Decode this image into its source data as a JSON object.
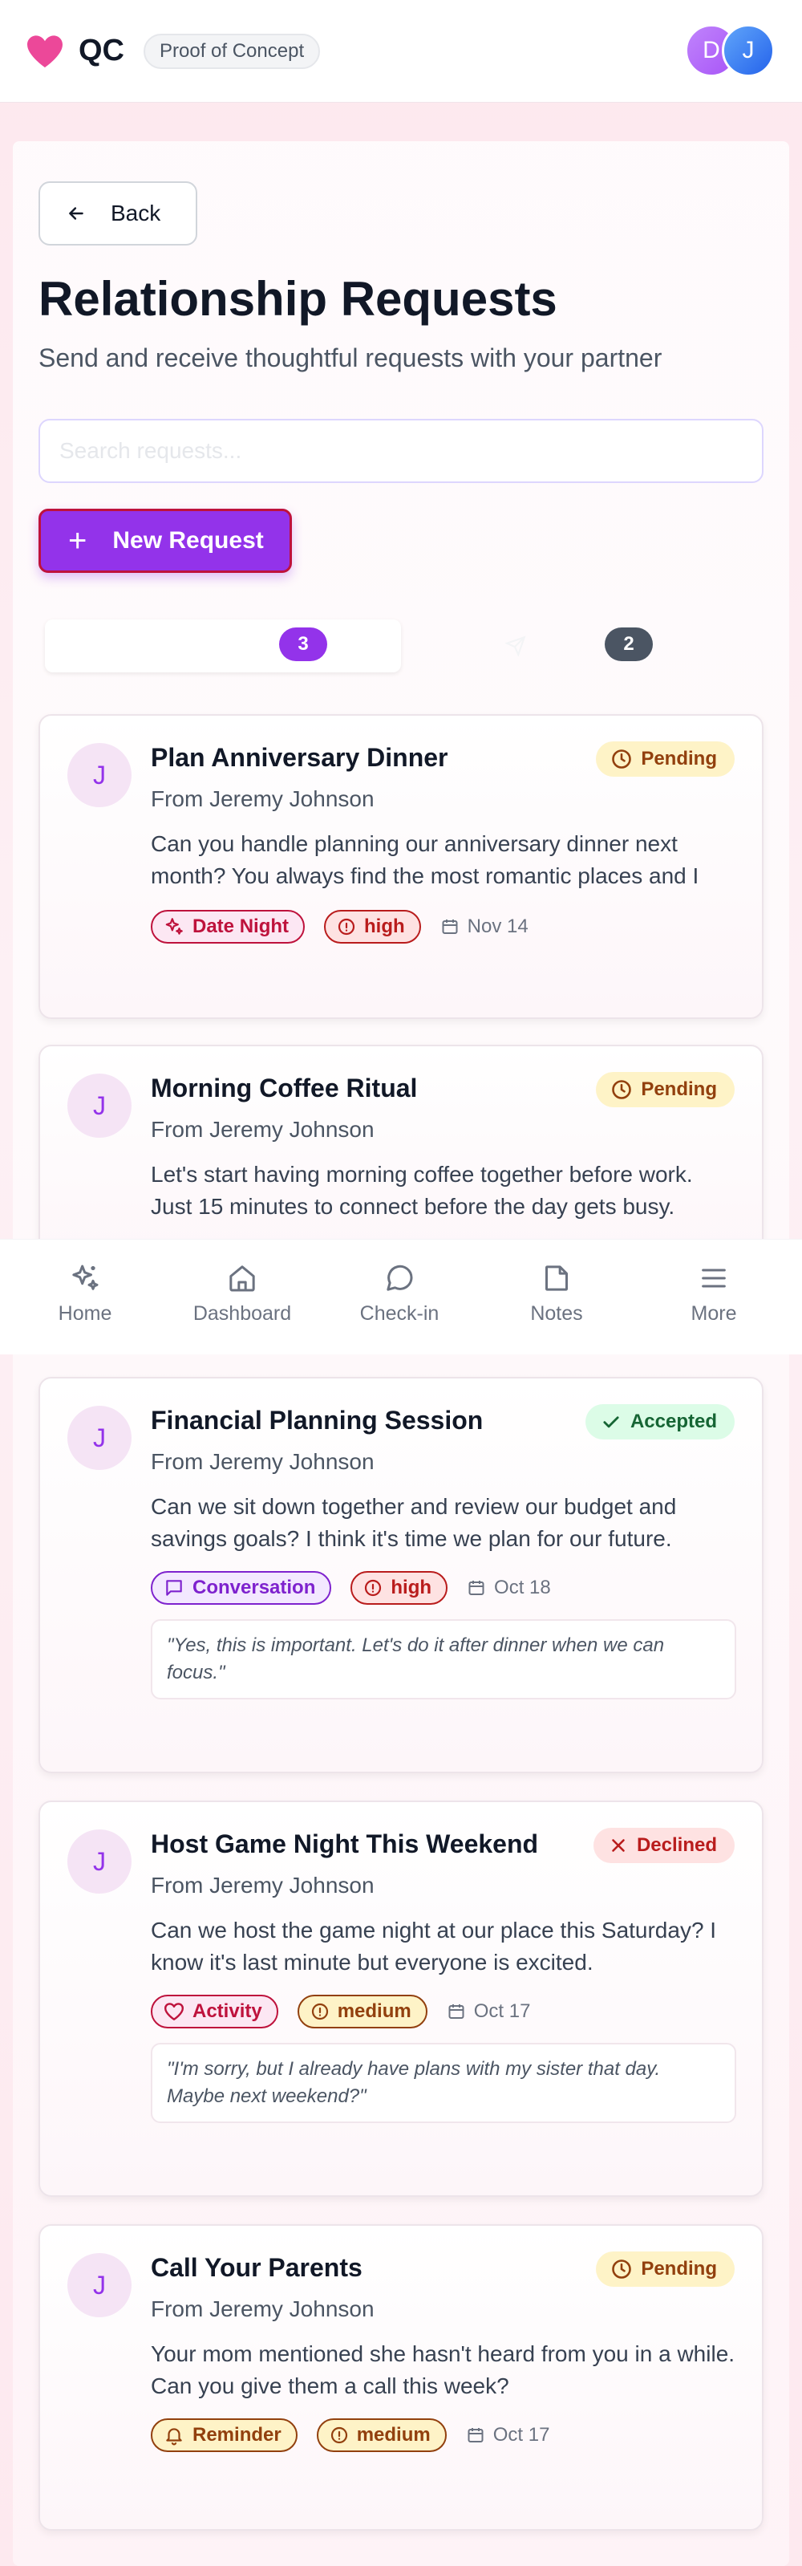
{
  "header": {
    "brand": "QC",
    "badge": "Proof of Concept",
    "avatars": [
      "D",
      "J"
    ]
  },
  "page": {
    "back_label": "Back",
    "title": "Relationship Requests",
    "subtitle": "Send and receive thoughtful requests with your partner",
    "search_placeholder": "Search requests...",
    "new_request_label": "New Request"
  },
  "tabs": {
    "received_count": "3",
    "sent_count": "2"
  },
  "cards": [
    {
      "avatar": "J",
      "title": "Plan Anniversary Dinner",
      "from": "From Jeremy Johnson",
      "message": "Can you handle planning our anniversary dinner next month? You always find the most romantic places and I love being surprised by what you choose.",
      "status": "Pending",
      "category": "Date Night",
      "priority": "high",
      "due": "Nov 14"
    },
    {
      "avatar": "J",
      "title": "Morning Coffee Ritual",
      "from": "From Jeremy Johnson",
      "message": "Let's start having morning coffee together before work. Just 15 minutes to connect before the day gets busy.",
      "status": "Pending"
    },
    {
      "avatar": "J",
      "title": "Financial Planning Session",
      "from": "From Jeremy Johnson",
      "message": "Can we sit down together and review our budget and savings goals? I think it's time we plan for our future.",
      "status": "Accepted",
      "category": "Conversation",
      "priority": "high",
      "due": "Oct 18",
      "response": "\"Yes, this is important. Let's do it after dinner when we can focus.\""
    },
    {
      "avatar": "J",
      "title": "Host Game Night This Weekend",
      "from": "From Jeremy Johnson",
      "message": "Can we host the game night at our place this Saturday? I know it's last minute but everyone is excited.",
      "status": "Declined",
      "category": "Activity",
      "priority": "medium",
      "due": "Oct 17",
      "response": "\"I'm sorry, but I already have plans with my sister that day. Maybe next weekend?\""
    },
    {
      "avatar": "J",
      "title": "Call Your Parents",
      "from": "From Jeremy Johnson",
      "message": "Your mom mentioned she hasn't heard from you in a while. Can you give them a call this week?",
      "status": "Pending",
      "category": "Reminder",
      "priority": "medium",
      "due": "Oct 17"
    }
  ],
  "nav": {
    "home": "Home",
    "dashboard": "Dashboard",
    "checkin": "Check-in",
    "notes": "Notes",
    "more": "More"
  },
  "colors": {
    "accent": "#9333ea",
    "brand_heart": "#ec4899",
    "pending": "#fef3c7",
    "accepted": "#dcfce7",
    "declined": "#fee2e2"
  }
}
